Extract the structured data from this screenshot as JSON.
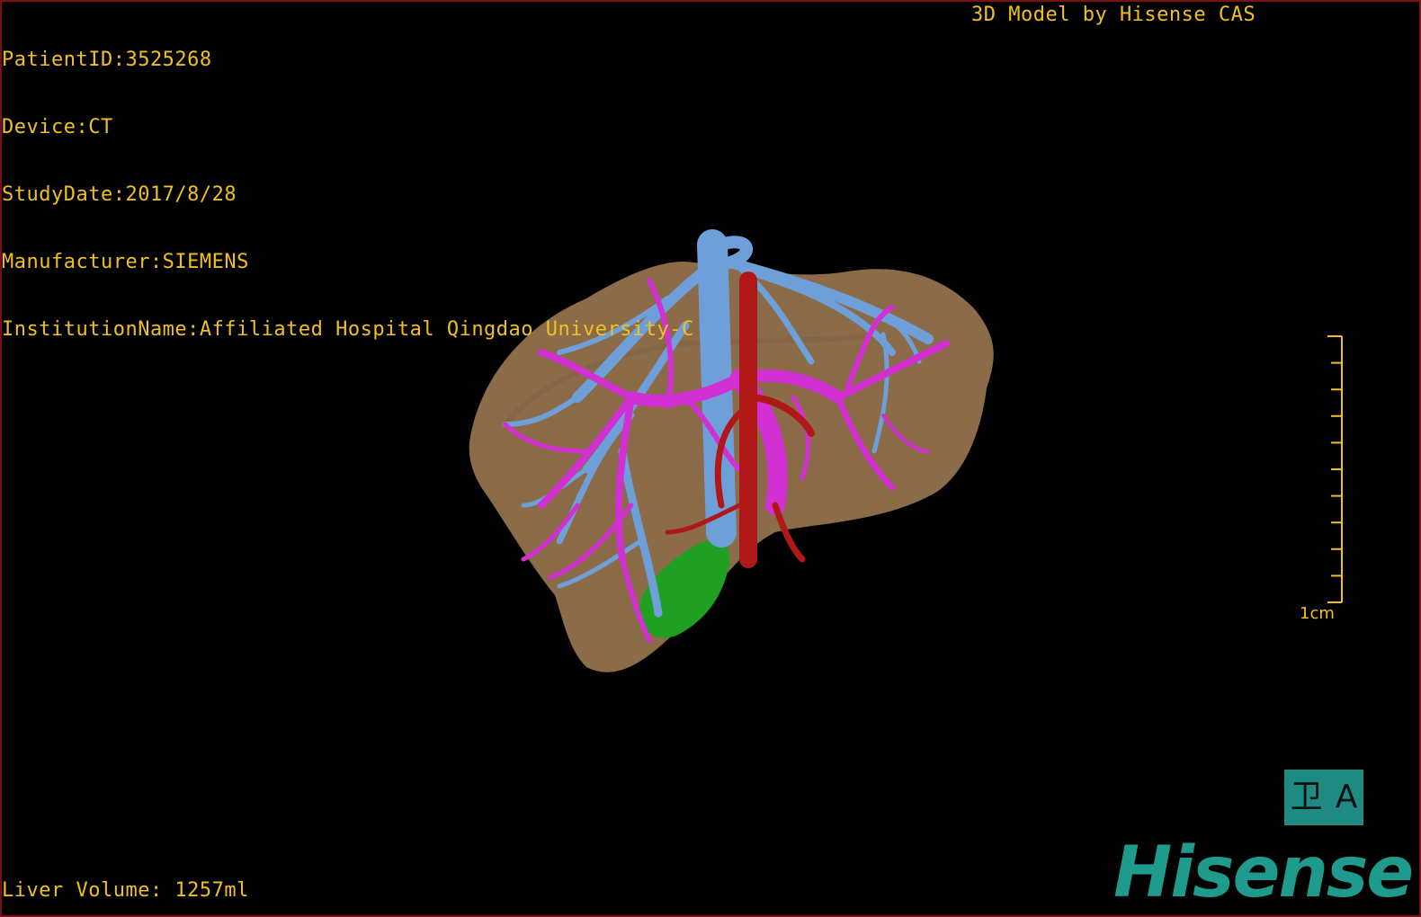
{
  "info": {
    "patient_id": "PatientID:3525268",
    "device": "Device:CT",
    "study_date": "StudyDate:2017/8/28",
    "manufacturer": "Manufacturer:SIEMENS",
    "institution": "InstitutionName:Affiliated Hospital Qingdao University-C"
  },
  "credit": "3D Model by Hisense CAS",
  "liver_volume": "Liver Volume: 1257ml",
  "scale": {
    "label": "1cm",
    "ticks": 11
  },
  "view_toggle": {
    "left_glyph": "卫",
    "right_glyph": "A"
  },
  "brand": "Hisense",
  "colors": {
    "text": "#f0c020",
    "liver": "#8b6b48",
    "hepatic_vein": "#6e9fd8",
    "portal_vein": "#d330d3",
    "artery": "#b01818",
    "gallbladder": "#1fa022",
    "brand": "#1f9b8e"
  }
}
